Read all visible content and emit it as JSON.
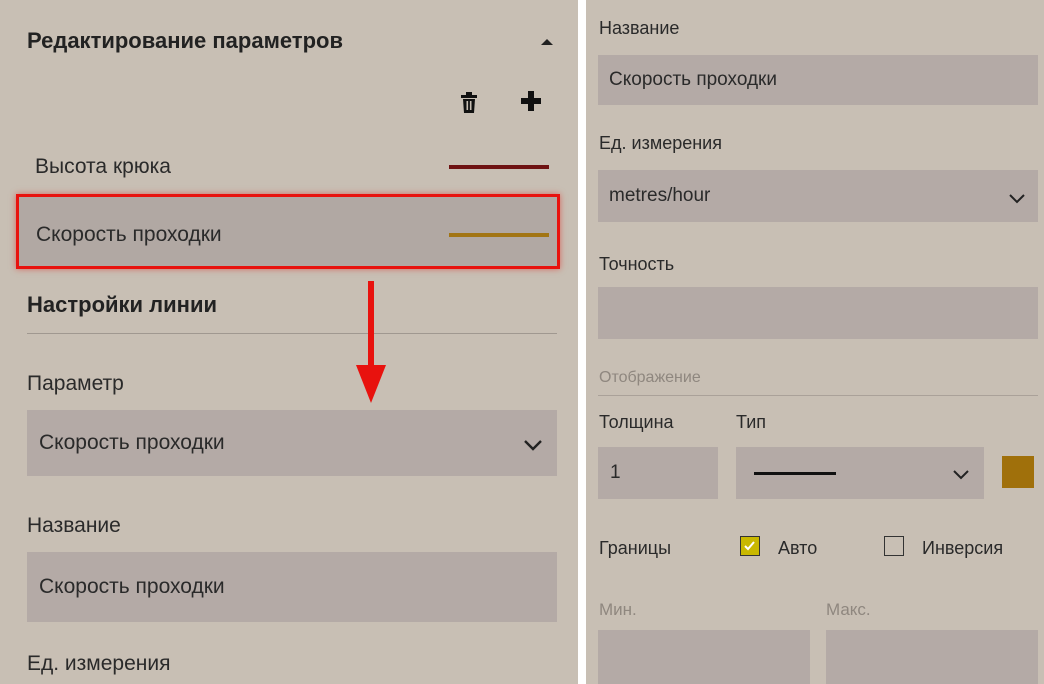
{
  "left": {
    "section_title": "Редактирование параметров",
    "params": [
      {
        "label": "Высота крюка",
        "line_color": "#6e1212"
      },
      {
        "label": "Скорость проходки",
        "line_color": "#a27514"
      }
    ],
    "line_settings_title": "Настройки линии",
    "parameter_label": "Параметр",
    "parameter_value": "Скорость проходки",
    "name_label": "Название",
    "name_value": "Скорость проходки",
    "unit_label": "Ед. измерения"
  },
  "right": {
    "name_label": "Название",
    "name_value": "Скорость проходки",
    "unit_label": "Ед. измерения",
    "unit_value": "metres/hour",
    "precision_label": "Точность",
    "precision_value": "",
    "display_section": "Отображение",
    "thickness_label": "Толщина",
    "thickness_value": "1",
    "type_label": "Тип",
    "color_swatch": "#a0700b",
    "bounds_label": "Границы",
    "auto_label": "Авто",
    "auto_checked": true,
    "inversion_label": "Инверсия",
    "inversion_checked": false,
    "min_label": "Мин.",
    "max_label": "Макс."
  },
  "colors": {
    "highlight": "#e8120e",
    "arrow": "#e8120e",
    "checkbox_fill": "#c9b800"
  }
}
